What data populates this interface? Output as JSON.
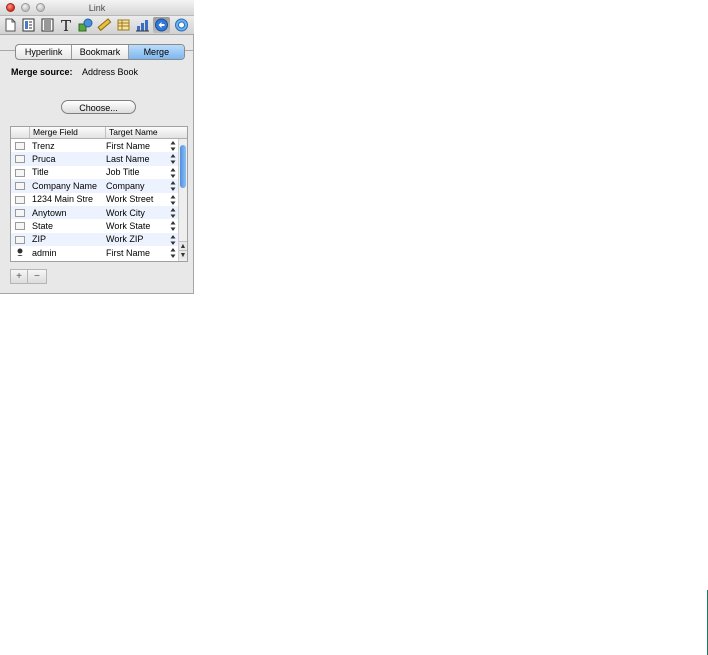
{
  "window": {
    "title": "Link"
  },
  "toolbar": {
    "icons": [
      "document-icon",
      "layout-icon",
      "wrap-icon",
      "text-icon",
      "graphic-icon",
      "metrics-icon",
      "table-icon",
      "chart-icon",
      "link-icon",
      "quicktime-icon"
    ],
    "selected_index": 8
  },
  "tabs": [
    {
      "label": "Hyperlink",
      "active": false
    },
    {
      "label": "Bookmark",
      "active": false
    },
    {
      "label": "Merge",
      "active": true
    }
  ],
  "merge_source": {
    "label": "Merge source:",
    "value": "Address Book"
  },
  "choose_label": "Choose...",
  "table": {
    "columns": [
      "Merge Field",
      "Target Name"
    ],
    "rows": [
      {
        "field": "Trenz",
        "target": "First Name",
        "icon": "card-icon"
      },
      {
        "field": "Pruca",
        "target": "Last Name",
        "icon": "card-icon"
      },
      {
        "field": "Title",
        "target": "Job Title",
        "icon": "card-icon"
      },
      {
        "field": "Company Name",
        "target": "Company",
        "icon": "card-icon"
      },
      {
        "field": "1234 Main Stre",
        "target": "Work Street",
        "icon": "card-icon"
      },
      {
        "field": "Anytown",
        "target": "Work City",
        "icon": "card-icon"
      },
      {
        "field": "State",
        "target": "Work State",
        "icon": "card-icon"
      },
      {
        "field": "ZIP",
        "target": "Work ZIP",
        "icon": "card-icon"
      },
      {
        "field": "admin",
        "target": "First Name",
        "icon": "person-icon"
      }
    ]
  },
  "buttons": {
    "add": "+",
    "remove": "−"
  },
  "colors": {
    "accent": "#7db7ef",
    "alt_row": "#edf3fe",
    "scroll_thumb": "#4f8fe0"
  }
}
